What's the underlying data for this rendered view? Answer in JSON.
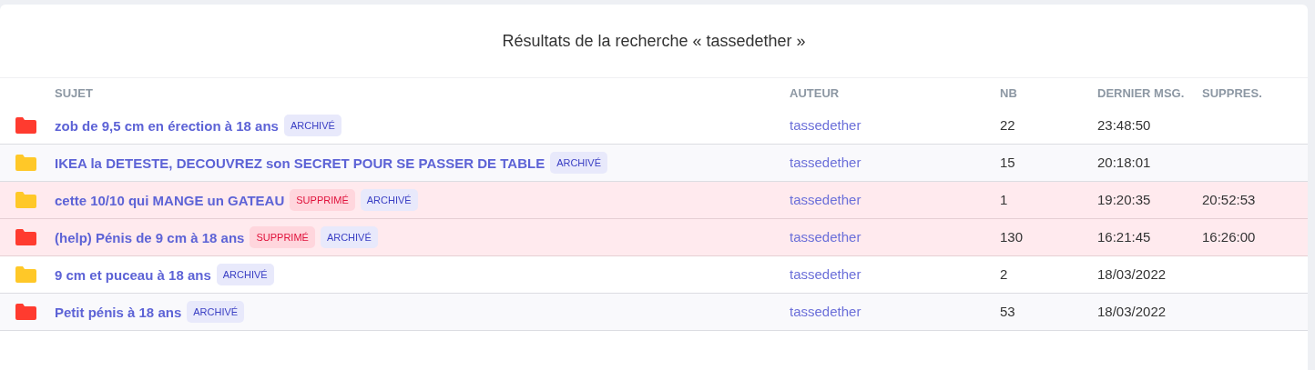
{
  "title": "Résultats de la recherche « tassedether »",
  "columns": [
    "SUJET",
    "AUTEUR",
    "NB",
    "DERNIER MSG.",
    "SUPPRES."
  ],
  "rows": [
    {
      "color": "#ff3b2f",
      "subject": "zob de 9,5 cm en érection à 18 ans",
      "badges": [
        {
          "kind": "archived",
          "label": "ARCHIVÉ"
        }
      ],
      "author": "tassedether",
      "count": "22",
      "last": "23:48:50",
      "deleted": false
    },
    {
      "color": "#ffc828",
      "subject": "IKEA la DETESTE, DECOUVREZ son SECRET POUR SE PASSER DE TABLE",
      "badges": [
        {
          "kind": "archived",
          "label": "ARCHIVÉ"
        }
      ],
      "author": "tassedether",
      "count": "15",
      "last": "20:18:01",
      "deleted": false
    },
    {
      "color": "#ffc828",
      "subject": "cette 10/10 qui MANGE un GATEAU",
      "badges": [
        {
          "kind": "deleted",
          "label": "SUPPRIMÉ"
        },
        {
          "kind": "archived",
          "label": "ARCHIVÉ"
        }
      ],
      "author": "tassedether",
      "count": "1",
      "last": "19:20:35",
      "deleted_at": "20:52:53",
      "deleted": true
    },
    {
      "color": "#ff3b2f",
      "subject": "(help) Pénis de 9 cm à 18 ans",
      "badges": [
        {
          "kind": "deleted",
          "label": "SUPPRIMÉ"
        },
        {
          "kind": "archived",
          "label": "ARCHIVÉ"
        }
      ],
      "author": "tassedether",
      "count": "130",
      "last": "16:21:45",
      "deleted_at": "16:26:00",
      "deleted": true
    },
    {
      "color": "#ffc828",
      "subject": "9 cm et puceau à 18 ans",
      "badges": [
        {
          "kind": "archived",
          "label": "ARCHIVÉ"
        }
      ],
      "author": "tassedether",
      "count": "2",
      "last": "18/03/2022",
      "deleted": false
    },
    {
      "color": "#ff3b2f",
      "subject": "Petit pénis à 18 ans",
      "badges": [
        {
          "kind": "archived",
          "label": "ARCHIVÉ"
        }
      ],
      "author": "tassedether",
      "count": "53",
      "last": "18/03/2022",
      "deleted": false
    }
  ]
}
